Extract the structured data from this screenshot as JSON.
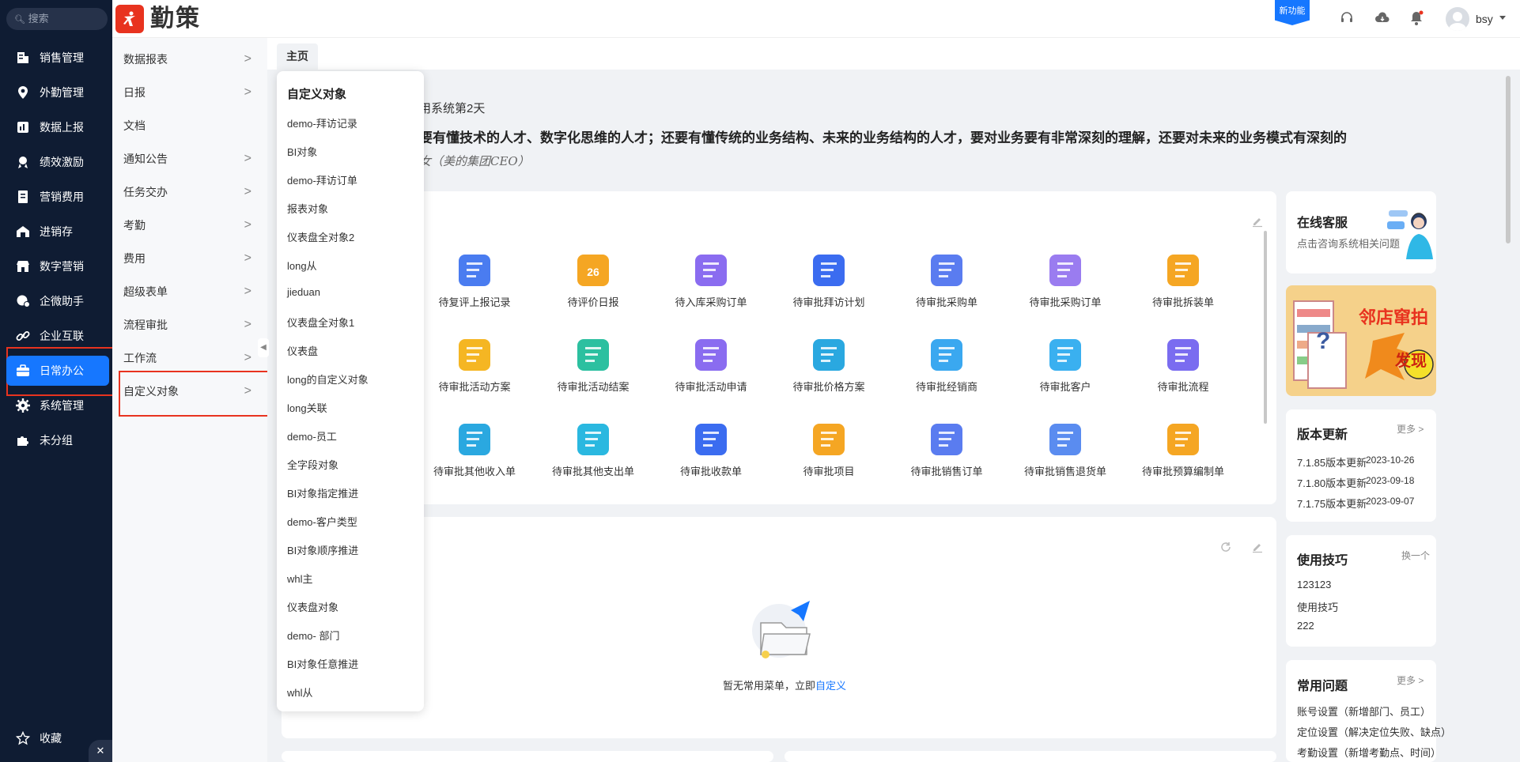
{
  "search": {
    "placeholder": "搜索"
  },
  "sidebar": {
    "items": [
      {
        "label": "销售管理",
        "icon": "building-icon"
      },
      {
        "label": "外勤管理",
        "icon": "location-pin-icon"
      },
      {
        "label": "数据上报",
        "icon": "report-icon"
      },
      {
        "label": "绩效激励",
        "icon": "medal-icon"
      },
      {
        "label": "营销费用",
        "icon": "ledger-icon"
      },
      {
        "label": "进销存",
        "icon": "warehouse-icon"
      },
      {
        "label": "数字营销",
        "icon": "store-icon"
      },
      {
        "label": "企微助手",
        "icon": "chat-assistant-icon"
      },
      {
        "label": "企业互联",
        "icon": "link-icon"
      },
      {
        "label": "日常办公",
        "icon": "briefcase-icon",
        "active": true
      },
      {
        "label": "系统管理",
        "icon": "gear-icon"
      },
      {
        "label": "未分组",
        "icon": "puzzle-icon"
      }
    ],
    "favorites": "收藏"
  },
  "brand": {
    "name": "勤策"
  },
  "header": {
    "new_feature": "新功能",
    "user": "bsy"
  },
  "submenu": {
    "items": [
      {
        "label": "数据报表",
        "arrow": ">"
      },
      {
        "label": "日报",
        "arrow": ">"
      },
      {
        "label": "文档",
        "arrow": ""
      },
      {
        "label": "通知公告",
        "arrow": ">"
      },
      {
        "label": "任务交办",
        "arrow": ">"
      },
      {
        "label": "考勤",
        "arrow": ">"
      },
      {
        "label": "费用",
        "arrow": ">"
      },
      {
        "label": "超级表单",
        "arrow": ">"
      },
      {
        "label": "流程审批",
        "arrow": ">"
      },
      {
        "label": "工作流",
        "arrow": ">"
      },
      {
        "label": "自定义对象",
        "arrow": ">"
      }
    ]
  },
  "tab": {
    "home": "主页"
  },
  "dropdown": {
    "title": "自定义对象",
    "items": [
      "demo-拜访记录",
      "BI对象",
      "demo-拜访订单",
      "报表对象",
      "仪表盘全对象2",
      "long从",
      "jieduan",
      "仪表盘全对象1",
      "仪表盘",
      "long的自定义对象",
      "long关联",
      "demo-员工",
      "全字段对象",
      "BI对象指定推进",
      "demo-客户类型",
      "BI对象顺序推进",
      "whl主",
      "仪表盘对象",
      "demo- 部门",
      "BI对象任意推进",
      "whl从"
    ]
  },
  "welcome": {
    "days": "用系统第2天",
    "quote": "要有懂技术的人才、数字化思维的人才；还要有懂传统的业务结构、未来的业务结构的人才，要对业务要有非常深刻的理解，还要对未来的业务模式有深刻的",
    "author": "女（美的集团CEO）"
  },
  "todos": [
    {
      "label": "待复评上报记录",
      "color": "#4a7cf0"
    },
    {
      "label": "待评价日报",
      "color": "#f5a623",
      "badge": "26"
    },
    {
      "label": "待入库采购订单",
      "color": "#8a6cf0"
    },
    {
      "label": "待审批拜访计划",
      "color": "#3b6cf0"
    },
    {
      "label": "待审批采购单",
      "color": "#5a7cf0"
    },
    {
      "label": "待审批采购订单",
      "color": "#9a7cf0"
    },
    {
      "label": "待审批拆装单",
      "color": "#f5a623"
    },
    {
      "label": "待审批活动方案",
      "color": "#f5b623"
    },
    {
      "label": "待审批活动结案",
      "color": "#2cc0a0"
    },
    {
      "label": "待审批活动申请",
      "color": "#8a6cf0"
    },
    {
      "label": "待审批价格方案",
      "color": "#2aa8e0"
    },
    {
      "label": "待审批经销商",
      "color": "#3aa8f0"
    },
    {
      "label": "待审批客户",
      "color": "#3ab0f0"
    },
    {
      "label": "待审批流程",
      "color": "#7a6cf0"
    },
    {
      "label": "待审批其他收入单",
      "color": "#2aa8e0"
    },
    {
      "label": "待审批其他支出单",
      "color": "#2ab8e0"
    },
    {
      "label": "待审批收款单",
      "color": "#3b6cf0"
    },
    {
      "label": "待审批项目",
      "color": "#f5a623"
    },
    {
      "label": "待审批销售订单",
      "color": "#5a7cf0"
    },
    {
      "label": "待审批销售退货单",
      "color": "#5a8cf0"
    },
    {
      "label": "待审批预算编制单",
      "color": "#f5a623"
    }
  ],
  "empty": {
    "text": "暂无常用菜单，立即",
    "link": "自定义"
  },
  "service": {
    "title": "在线客服",
    "sub": "点击咨询系统相关问题"
  },
  "banner": {
    "text1": "邻店窜拍",
    "text2": "发现"
  },
  "updates": {
    "title": "版本更新",
    "more": "更多 >",
    "items": [
      {
        "name": "7.1.85版本更新",
        "date": "2023-10-26"
      },
      {
        "name": "7.1.80版本更新",
        "date": "2023-09-18"
      },
      {
        "name": "7.1.75版本更新",
        "date": "2023-09-07"
      }
    ]
  },
  "tips": {
    "title": "使用技巧",
    "more": "换一个",
    "items": [
      "123123",
      "使用技巧",
      "222"
    ]
  },
  "faq": {
    "title": "常用问题",
    "more": "更多 >",
    "items": [
      "账号设置（新增部门、员工）",
      "定位设置（解决定位失败、缺点）",
      "考勤设置（新增考勤点、时间）"
    ]
  }
}
